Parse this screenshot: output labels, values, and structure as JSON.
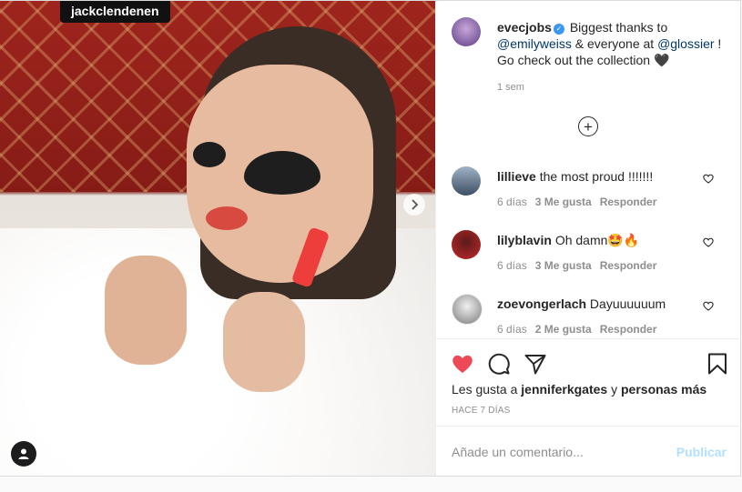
{
  "photo": {
    "user_tag": "jackclendenen",
    "icons": {
      "next": "chevron-right-icon",
      "tagged_users": "user-icon"
    }
  },
  "post": {
    "author": "evecjobs",
    "caption_intro": "Biggest thanks to",
    "mention1": "@emilyweiss",
    "caption_mid": "& everyone at",
    "mention2": "@glossier",
    "caption_end": "! Go check out the collection 🖤",
    "time": "1 sem",
    "load_more_icon": "plus-circle-icon"
  },
  "comments": [
    {
      "user": "lillieve",
      "text": "the most proud !!!!!!!",
      "age": "6 días",
      "likes": "3 Me gusta",
      "reply": "Responder"
    },
    {
      "user": "lilyblavin",
      "text": "Oh damn🤩🔥",
      "age": "6 días",
      "likes": "3 Me gusta",
      "reply": "Responder"
    },
    {
      "user": "zoevongerlach",
      "text": "Dayuuuuuum",
      "age": "6 días",
      "likes": "2 Me gusta",
      "reply": "Responder"
    }
  ],
  "actions": {
    "icons": [
      "heart-icon",
      "comment-icon",
      "share-icon",
      "bookmark-icon"
    ],
    "like_color": "#ed4956"
  },
  "likes": {
    "prefix": "Les gusta a",
    "user": "jenniferkgates",
    "joiner": "y",
    "others": "personas más"
  },
  "posted_ago": "HACE 7 DÍAS",
  "add_comment": {
    "placeholder": "Añade un comentario...",
    "publish": "Publicar"
  },
  "colors": {
    "link": "#00376b",
    "verified": "#3897f0",
    "publish_disabled": "#b2dffc"
  }
}
